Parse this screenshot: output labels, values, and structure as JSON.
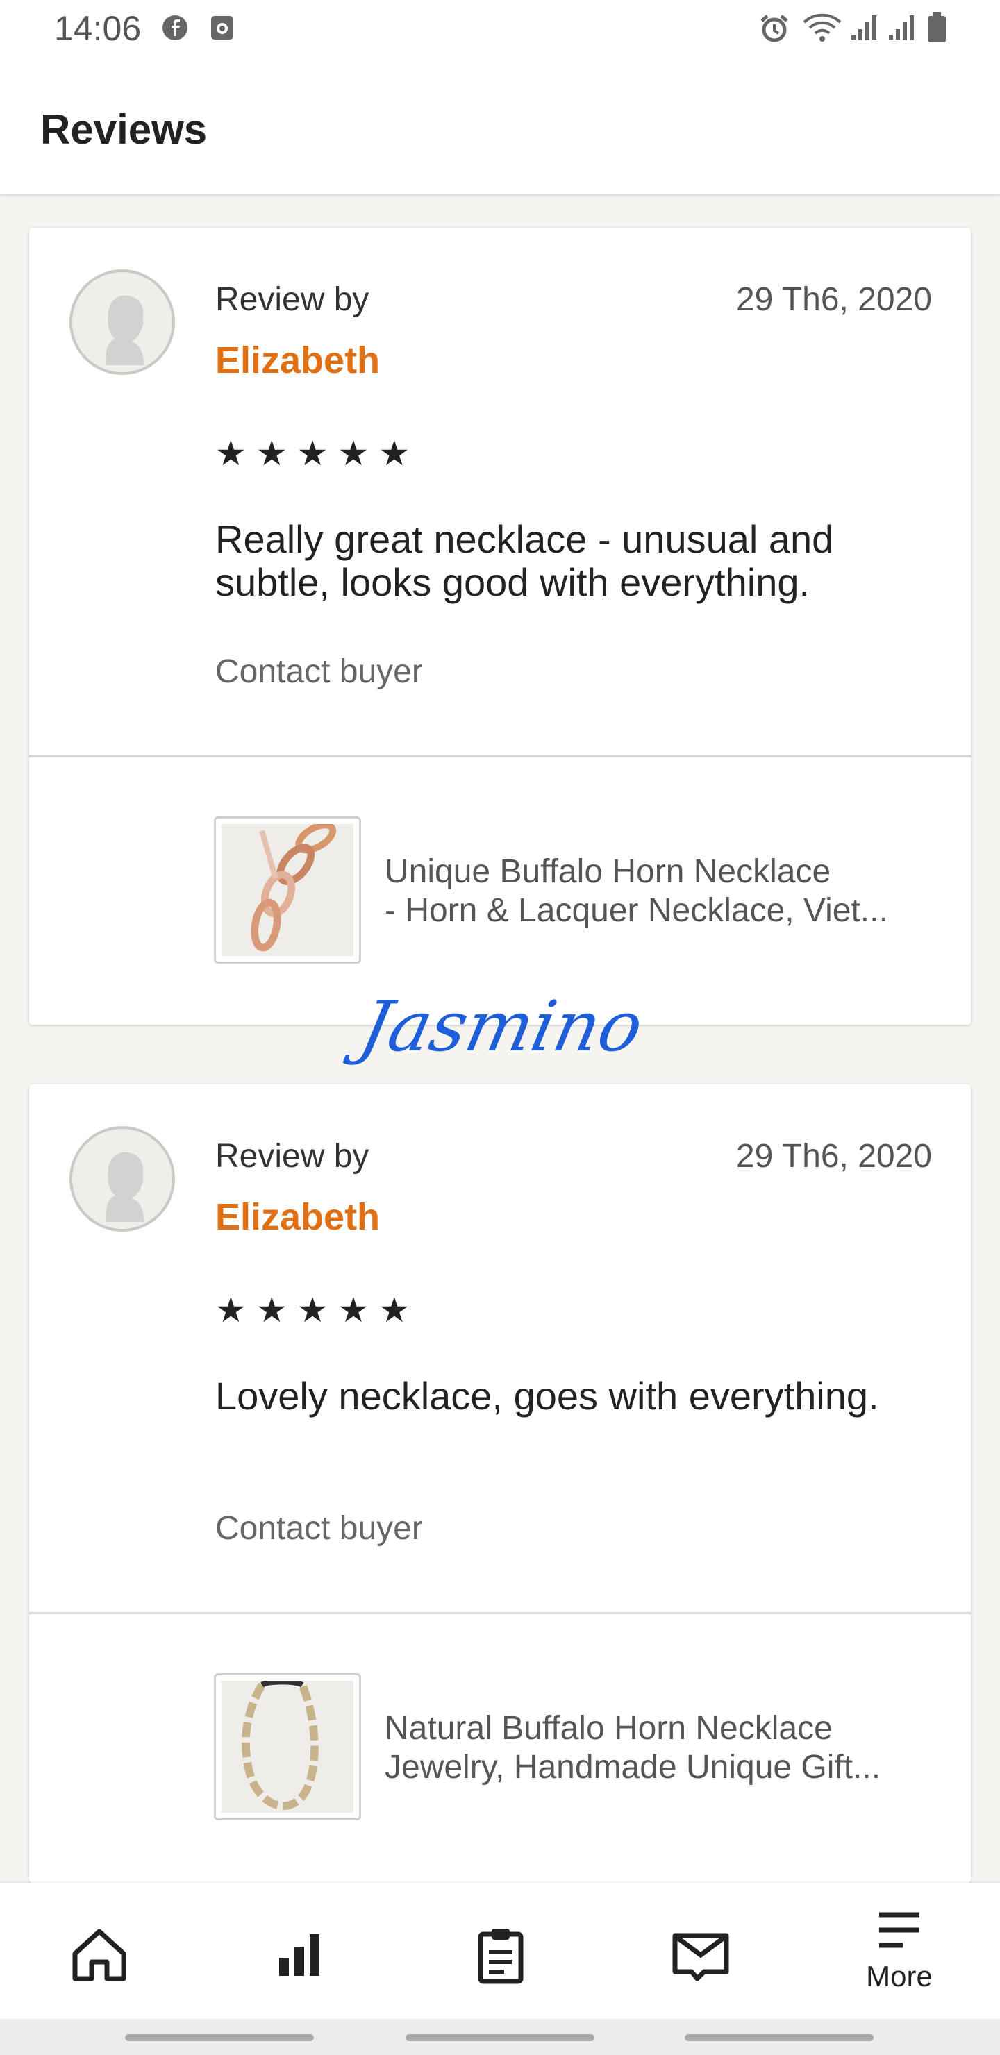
{
  "status_bar": {
    "time": "14:06"
  },
  "header": {
    "title": "Reviews"
  },
  "reviews": [
    {
      "review_by_label": "Review by",
      "reviewer": "Elizabeth",
      "date": "29 Th6, 2020",
      "rating": 5,
      "stars": [
        "★",
        "★",
        "★",
        "★",
        "★"
      ],
      "text": "Really great necklace - unusual and subtle, looks good with everything.",
      "contact_label": "Contact buyer",
      "listing_line1": "Unique Buffalo Horn Necklace",
      "listing_line2": "- Horn & Lacquer Necklace, Viet..."
    },
    {
      "review_by_label": "Review by",
      "reviewer": "Elizabeth",
      "date": "29 Th6, 2020",
      "rating": 5,
      "stars": [
        "★",
        "★",
        "★",
        "★",
        "★"
      ],
      "text": "Lovely necklace, goes with everything.",
      "contact_label": "Contact buyer",
      "listing_line1": "Natural Buffalo Horn Necklace",
      "listing_line2": "Jewelry, Handmade Unique Gift..."
    }
  ],
  "watermark": "Jasmino",
  "bottom_nav": {
    "items": [
      "home-icon",
      "stats-icon",
      "orders-icon",
      "messages-icon",
      "menu-icon"
    ],
    "more_label": "More"
  },
  "colors": {
    "accent": "#e07013",
    "watermark": "#1e5ed8"
  }
}
